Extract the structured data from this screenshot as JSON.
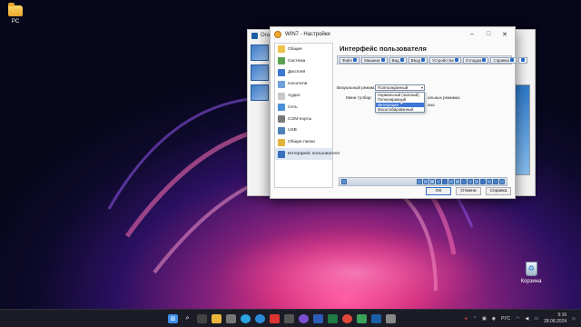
{
  "desktop": {
    "pc_label": "PC",
    "recycle_label": "Корзина"
  },
  "manager": {
    "title_fragment": "Orac"
  },
  "dialog": {
    "title": "WIN7 - Настройки",
    "page_title": "Интерфейс пользователя",
    "nav": [
      {
        "label": "Общие",
        "color": "#f0c24a"
      },
      {
        "label": "Система",
        "color": "#5ba352"
      },
      {
        "label": "Дисплей",
        "color": "#3b78d0"
      },
      {
        "label": "Носители",
        "color": "#6fa0d8"
      },
      {
        "label": "Аудио",
        "color": "#c8c8c8"
      },
      {
        "label": "Сеть",
        "color": "#4b8fd6"
      },
      {
        "label": "COM-порты",
        "color": "#7a7a7a"
      },
      {
        "label": "USB",
        "color": "#4b7fb8"
      },
      {
        "label": "Общие папки",
        "color": "#e3b33c"
      },
      {
        "label": "Интерфейс пользователя",
        "color": "#3a6fc0"
      }
    ],
    "menubar": [
      "Файл",
      "Машина",
      "Вид",
      "Ввод",
      "Устройства",
      "Отладка",
      "Справка"
    ],
    "visual_mode_label": "Визуальный режим:",
    "visual_mode_value": "Полноэкранный",
    "minibar_label": "Мини тулбар:",
    "minibar_text_tail": "альных режимах",
    "minibar_text_tail2": "ана",
    "dropdown_options": [
      "Нормальный (оконный)",
      "Полноэкранный",
      "Интеграция",
      "Масштабированный"
    ],
    "dropdown_highlight_index": 2,
    "buttons": {
      "ok": "ОК",
      "cancel": "Отмена",
      "help": "Справка"
    }
  },
  "taskbar": {
    "lang": "РУС",
    "time": "9:16",
    "date": "28.08.2024"
  }
}
